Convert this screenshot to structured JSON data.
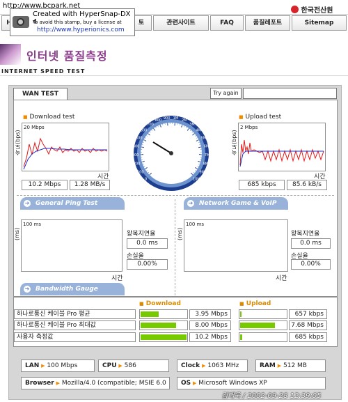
{
  "watermark": {
    "url_top": "http://www.bcpark.net",
    "line1": "Created with HyperSnap-DX 4",
    "line2": "To avoid this stamp, buy a license at",
    "line3": "http://www.hyperionics.com"
  },
  "header": {
    "logo_text": "한국전산원",
    "nav_items": [
      "토",
      "관련사이트",
      "FAQ",
      "품질레포트",
      "Sitemap"
    ],
    "nav_first_fragment": "H"
  },
  "banner": {
    "title": "인터넷 품질측정",
    "subtitle": "INTERNET SPEED TEST"
  },
  "tabs": {
    "wan_test": "WAN TEST",
    "try_again": "Try again"
  },
  "download": {
    "label": "Download test",
    "axis_label": "속도(bps)",
    "ymax": "20 Mbps",
    "time_label": "시간",
    "speed_bps": "10.2 Mbps",
    "speed_bytes": "1.28 MB/s"
  },
  "upload": {
    "label": "Upload test",
    "axis_label": "속도(bps)",
    "ymax": "2 Mbps",
    "time_label": "시간",
    "speed_bps": "685 kbps",
    "speed_bytes": "85.6 kB/s"
  },
  "gauge": {
    "ticks": [
      "0",
      "100",
      "200",
      "300",
      "400",
      "500",
      "600",
      "700",
      "800",
      "900",
      "1M",
      "2M",
      "3M",
      "4M",
      "5M",
      "6M",
      "7M",
      "8M",
      "9M",
      "10M"
    ]
  },
  "ping": {
    "title": "General Ping Test",
    "axis_label": "(ms)",
    "ymax": "100 ms",
    "time_label": "시간",
    "rtt_label": "왕복지연율",
    "rtt_value": "0.0 ms",
    "loss_label": "손실율",
    "loss_value": "0.00%"
  },
  "voip": {
    "title": "Network Game & VoIP Test",
    "axis_label": "(ms)",
    "ymax": "100 ms",
    "time_label": "시간",
    "rtt_label": "왕복지연율",
    "rtt_value": "0.0 ms",
    "loss_label": "손실율",
    "loss_value": "0.00%"
  },
  "bandwidth": {
    "title": "Bandwidth Gauge",
    "download_header": "Download",
    "upload_header": "Upload",
    "rows": [
      {
        "label": "하나로통신 케이블 Pro 평균",
        "down": "3.95 Mbps",
        "down_frac": 0.39,
        "up": "657 kbps",
        "up_frac": 0.03
      },
      {
        "label": "하나로통신 케이블 Pro 최대값",
        "down": "8.00 Mbps",
        "down_frac": 0.78,
        "up": "7.68 Mbps",
        "up_frac": 0.75
      },
      {
        "label": "사용자 측정값",
        "down": "10.2 Mbps",
        "down_frac": 1.0,
        "up": "685 kbps",
        "up_frac": 0.04
      }
    ]
  },
  "sysinfo": {
    "lan_label": "LAN",
    "lan_value": "100 Mbps",
    "cpu_label": "CPU",
    "cpu_value": "586",
    "clock_label": "Clock",
    "clock_value": "1063 MHz",
    "ram_label": "RAM",
    "ram_value": "512 MB",
    "browser_label": "Browser",
    "browser_value": "Mozilla/4.0 (compatible; MSIE 6.0",
    "os_label": "OS",
    "os_value": "Microsoft Windows XP"
  },
  "footer": {
    "timestamp": "김대욱 / 2002-09-28 12:39:05"
  }
}
